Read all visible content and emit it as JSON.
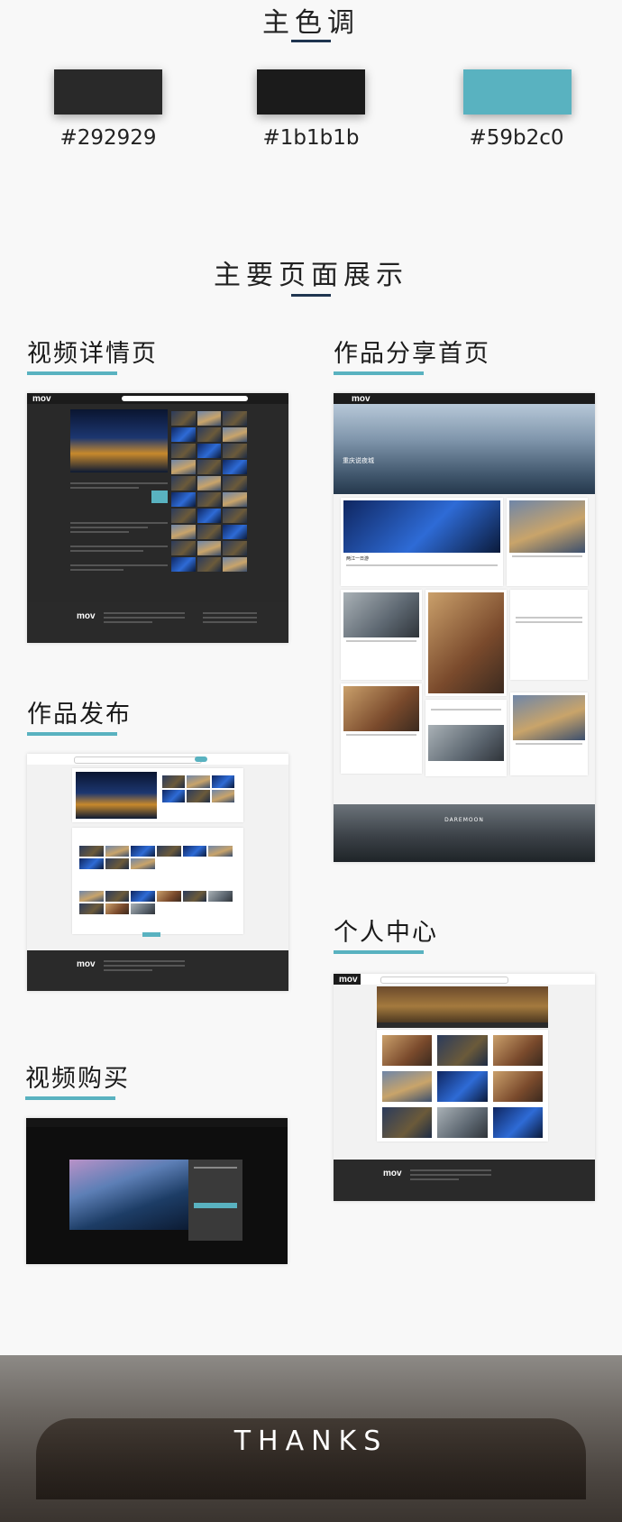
{
  "colors_section": {
    "title": "主色调",
    "swatches": [
      {
        "hex": "#292929",
        "label": "#292929"
      },
      {
        "hex": "#1b1b1b",
        "label": "#1b1b1b"
      },
      {
        "hex": "#59b2c0",
        "label": "#59b2c0"
      }
    ]
  },
  "pages_section": {
    "title": "主要页面展示",
    "video_detail": {
      "title": "视频详情页"
    },
    "works_home": {
      "title": "作品分享首页",
      "banner_text": "重庆说夜城",
      "footer_brand": "DAREMOON",
      "card_title": "两江一日游"
    },
    "works_publish": {
      "title": "作品发布"
    },
    "personal_center": {
      "title": "个人中心"
    },
    "video_purchase": {
      "title": "视频购买"
    }
  },
  "mock": {
    "logo": "mov"
  },
  "thanks": {
    "text": "THANKS"
  },
  "accent_color": "#59b2c0"
}
